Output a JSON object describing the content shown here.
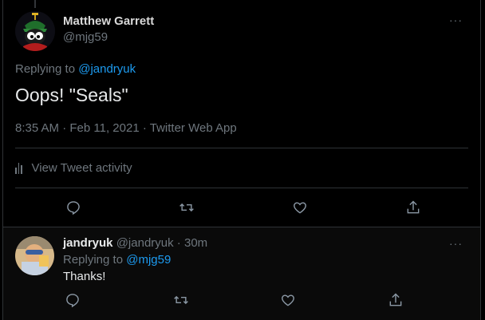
{
  "tweet": {
    "author_name": "Matthew Garrett",
    "author_handle": "@mjg59",
    "replying_prefix": "Replying to ",
    "replying_to": "@jandryuk",
    "text": "Oops! \"Seals\"",
    "time": "8:35 AM",
    "sep1": " · ",
    "date": "Feb 11, 2021",
    "sep2": " · ",
    "source": "Twitter Web App",
    "activity_label": "View Tweet activity",
    "more_label": "···"
  },
  "reply": {
    "author_name": "jandryuk",
    "author_handle": "@jandryuk",
    "sep": " · ",
    "age": "30m",
    "replying_prefix": "Replying to ",
    "replying_to": "@mjg59",
    "text": "Thanks!",
    "more_label": "···"
  },
  "colors": {
    "background": "#000000",
    "border": "#2f3336",
    "link": "#1d9bf0",
    "muted": "#6e767d",
    "text": "#e7e9ea"
  },
  "icons": {
    "actions": [
      "reply-icon",
      "retweet-icon",
      "like-icon",
      "share-icon"
    ],
    "activity": "bar-chart-icon",
    "more": "more-icon"
  }
}
